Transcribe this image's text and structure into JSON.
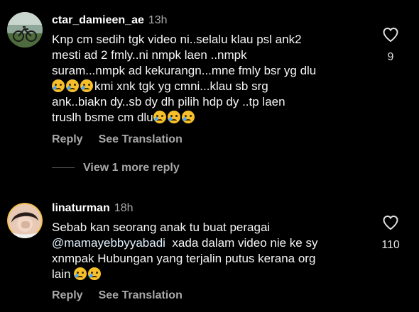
{
  "comments": [
    {
      "username": "ctar_damieen_ae",
      "time": "13h",
      "lines": [
        "Knp cm sedih tgk video ni..selalu klau  psl ank2",
        "mesti ad 2 fmly..ni nmpk laen ..nmpk",
        "suram...nmpk ad kekurangn...mne fmly bsr yg dlu",
        "kmi xnk tgk yg cmni...klau sb srg",
        "ank..biakn dy..sb dy dh pilih hdp dy ..tp laen",
        "truslh bsme cm dlu"
      ],
      "likes": "9",
      "reply_label": "Reply",
      "translate_label": "See Translation",
      "more_replies": "View 1 more reply"
    },
    {
      "username": "linaturman",
      "time": "18h",
      "lines": [
        "Sebab kan seorang anak tu buat peragai",
        "xada dalam video nie ke sy",
        "xnmpak Hubungan yang terjalin putus kerana org",
        "lain"
      ],
      "mention": "@mamayebbyyabadi",
      "likes": "110",
      "reply_label": "Reply",
      "translate_label": "See Translation"
    }
  ],
  "icons": {
    "like": "heart-outline-icon",
    "emoji": "crying-face-emoji"
  },
  "colors": {
    "background": "#000000",
    "secondary_text": "#a8a8a8",
    "mention": "#e0f1ff"
  }
}
